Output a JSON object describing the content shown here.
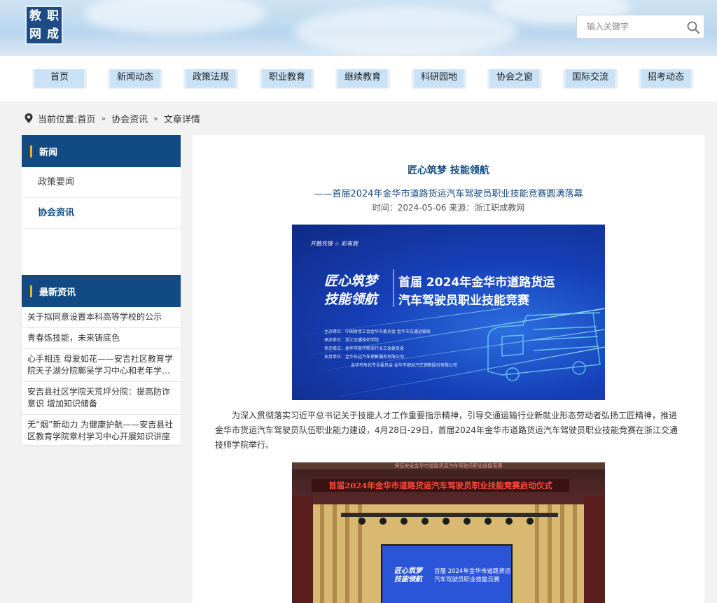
{
  "header": {
    "logo_chars": [
      "教",
      "职",
      "网",
      "成"
    ],
    "search_placeholder": "输入关键字",
    "search_icon": "search-icon"
  },
  "nav": {
    "items": [
      "首页",
      "新闻动态",
      "政策法规",
      "职业教育",
      "继续教育",
      "科研园地",
      "协会之窗",
      "国际交流",
      "招考动态"
    ]
  },
  "breadcrumb": {
    "prefix": "当前位置:",
    "items": [
      "首页",
      "协会资讯",
      "文章详情"
    ]
  },
  "sidebar": {
    "news_title": "新闻",
    "links": [
      {
        "label": "政策要闻",
        "active": false
      },
      {
        "label": "协会资讯",
        "active": true
      }
    ],
    "latest_title": "最新资讯",
    "latest": [
      "关于拟同意设置本科高等学校的公示",
      "青春炼技能，未来铸底色",
      "心手相连 母爱如花——安吉社区教育学院天子湖分院鄣吴学习中心和老年学校温馨开展母亲节活动",
      "安吉县社区学院天荒坪分院：提高防诈意识 增加知识储备",
      "无“烟”新动力 为健康护航——安吉县社区教育学院章村学习中心开展知识讲座"
    ]
  },
  "article": {
    "title": "匠心筑梦 技能领航",
    "subtitle": "——首届2024年金华市道路货运汽车驾驶员职业技能竞赛圆满落幕",
    "meta": "时间：2024-05-06  来源：浙江职成教网",
    "body": "为深入贯彻落实习近平总书记关于技能人才工作重要指示精神，引导交通运输行业新就业形态劳动者弘扬工匠精神，推进金华市货运汽车驾驶员队伍职业能力建设，4月28日-29日，首届2024年金华市道路货运汽车驾驶员职业技能竞赛在浙江交通技师学院举行。",
    "poster": {
      "slogan": "开路先锋 ☆ 彩有我",
      "left1": "匠心筑梦",
      "left2": "技能领航",
      "right1": "首届 2024年金华市道路货运",
      "right2": "汽车驾驶员职业技能竞赛",
      "credits": [
        "主办单位：中国财贸工会金华市委员会 金华市交通运输局",
        "承办单位：浙江交通技师学院",
        "协办单位：金华市现代物流行业工会委员会",
        "支持单位：金华东运汽车销售服务有限公司",
        "金华市危化专业委员会 金华市柳运汽车销售股份有限公司"
      ]
    },
    "photo2": {
      "top_text": "保证安全金华市道路货运汽车驾驶员职业技能竞赛",
      "banner": "首届2024年金华市道路货运汽车驾驶员职业技能竞赛启动仪式",
      "screen1": "匠心筑梦",
      "screen2": "技能领航",
      "screen3": "首届 2024年金华市道路货运",
      "screen4": "汽车驾驶员职业技能竞赛"
    }
  },
  "colors": {
    "brand_blue": "#124b83",
    "accent_gold": "#f1b320",
    "nav_tab": "#c9e2f6"
  }
}
